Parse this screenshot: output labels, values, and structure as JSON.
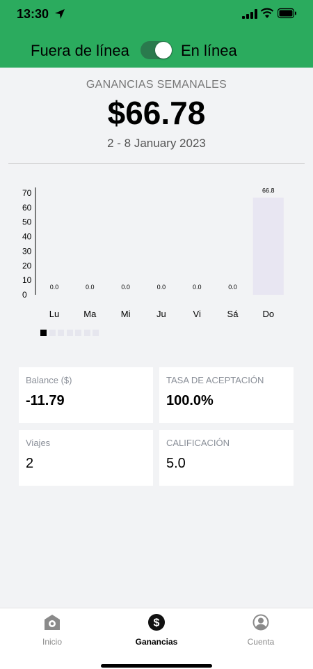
{
  "status_bar": {
    "time": "13:30"
  },
  "header": {
    "offline_label": "Fuera de línea",
    "online_label": "En línea",
    "online": true
  },
  "summary": {
    "title": "GANANCIAS SEMANALES",
    "amount": "$66.78",
    "date_range": "2 - 8 January 2023"
  },
  "chart_data": {
    "type": "bar",
    "categories": [
      "Lu",
      "Ma",
      "Mi",
      "Ju",
      "Vi",
      "Sá",
      "Do"
    ],
    "values": [
      0.0,
      0.0,
      0.0,
      0.0,
      0.0,
      0.0,
      66.8
    ],
    "value_labels": [
      "0.0",
      "0.0",
      "0.0",
      "0.0",
      "0.0",
      "0.0",
      "66.8"
    ],
    "y_ticks": [
      0,
      10,
      20,
      30,
      40,
      50,
      60,
      70
    ],
    "ylim": [
      0,
      70
    ],
    "bar_color": "#e8e6f2",
    "grid": false
  },
  "pager": {
    "total": 7,
    "active": 0
  },
  "stats": {
    "balance": {
      "label": "Balance ($)",
      "value": "-11.79"
    },
    "acceptance": {
      "label": "TASA DE ACEPTACIÓN",
      "value": "100.0%"
    },
    "trips": {
      "label": "Viajes",
      "value": "2"
    },
    "rating": {
      "label": "CALIFICACIÓN",
      "value": "5.0"
    }
  },
  "tabs": [
    {
      "label": "Inicio",
      "icon": "home-icon",
      "active": false
    },
    {
      "label": "Ganancias",
      "icon": "dollar-icon",
      "active": true
    },
    {
      "label": "Cuenta",
      "icon": "account-icon",
      "active": false
    }
  ],
  "colors": {
    "header_bg": "#2bab5e",
    "toggle_bg": "#2a7a4d",
    "card_bg": "#ffffff",
    "page_bg": "#f2f3f5"
  }
}
